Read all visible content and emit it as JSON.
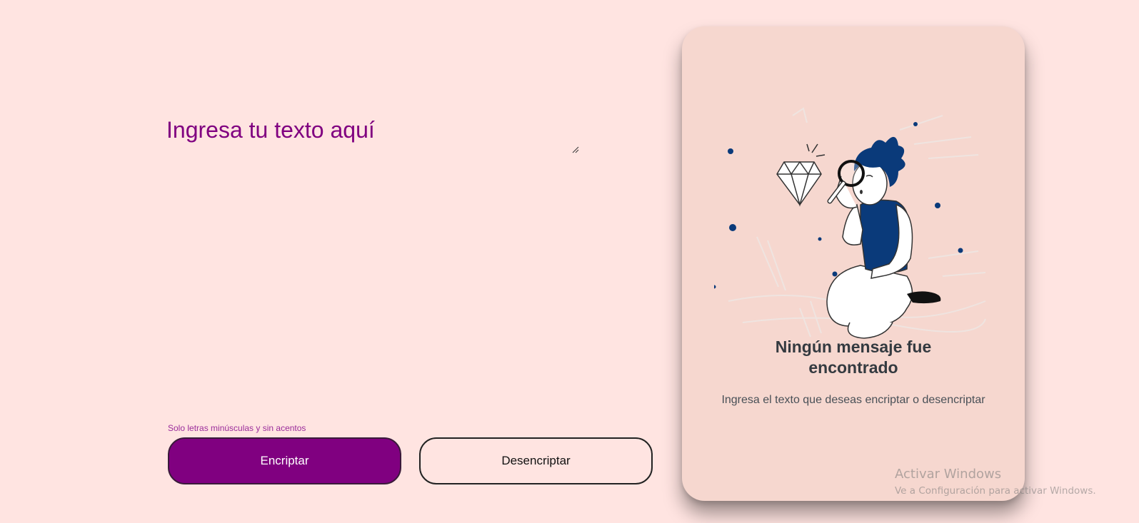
{
  "input": {
    "placeholder": "Ingresa tu texto aquí"
  },
  "hint": "Solo letras minúsculas y sin acentos",
  "buttons": {
    "encrypt": "Encriptar",
    "decrypt": "Desencriptar"
  },
  "output": {
    "title": "Ningún mensaje fue encontrado",
    "subtitle": "Ingresa el texto que deseas encriptar o desencriptar",
    "illustration_icon": "person-with-magnifier-and-diamond-illustration"
  },
  "watermark": {
    "title": "Activar Windows",
    "subtitle": "Ve a Configuración para activar Windows."
  },
  "colors": {
    "background": "#ffe4e1",
    "accent": "#800080",
    "card": "#f6d7cf",
    "figure_blue": "#0a3a7a"
  }
}
